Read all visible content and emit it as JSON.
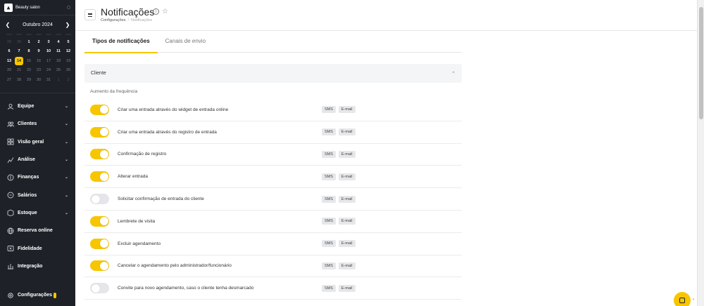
{
  "app": {
    "name": "Beauty salon"
  },
  "calendar": {
    "month": "Outubro 2024",
    "days": [
      {
        "d": "29",
        "t": "muted"
      },
      {
        "d": "30",
        "t": "muted"
      },
      {
        "d": "1",
        "t": "n"
      },
      {
        "d": "2",
        "t": "n"
      },
      {
        "d": "3",
        "t": "n"
      },
      {
        "d": "4",
        "t": "n"
      },
      {
        "d": "5",
        "t": "n"
      },
      {
        "d": "6",
        "t": "n"
      },
      {
        "d": "7",
        "t": "n"
      },
      {
        "d": "8",
        "t": "n"
      },
      {
        "d": "9",
        "t": "n"
      },
      {
        "d": "10",
        "t": "n"
      },
      {
        "d": "11",
        "t": "n"
      },
      {
        "d": "12",
        "t": "n"
      },
      {
        "d": "13",
        "t": "n"
      },
      {
        "d": "14",
        "t": "today"
      },
      {
        "d": "15",
        "t": "dim"
      },
      {
        "d": "16",
        "t": "dim"
      },
      {
        "d": "17",
        "t": "dim"
      },
      {
        "d": "18",
        "t": "dim"
      },
      {
        "d": "19",
        "t": "dim"
      },
      {
        "d": "20",
        "t": "dim"
      },
      {
        "d": "21",
        "t": "dim"
      },
      {
        "d": "22",
        "t": "dim"
      },
      {
        "d": "23",
        "t": "dim"
      },
      {
        "d": "24",
        "t": "dim"
      },
      {
        "d": "25",
        "t": "dim"
      },
      {
        "d": "26",
        "t": "dim"
      },
      {
        "d": "27",
        "t": "dim"
      },
      {
        "d": "28",
        "t": "dim"
      },
      {
        "d": "29",
        "t": "dim"
      },
      {
        "d": "30",
        "t": "dim"
      },
      {
        "d": "31",
        "t": "dim"
      },
      {
        "d": "1",
        "t": "muted"
      },
      {
        "d": "2",
        "t": "muted"
      }
    ]
  },
  "nav": [
    {
      "label": "Equipe",
      "icon": "user-icon",
      "chevron": true
    },
    {
      "label": "Clientes",
      "icon": "users-icon",
      "chevron": true
    },
    {
      "label": "Visão geral",
      "icon": "grid-icon",
      "chevron": true
    },
    {
      "label": "Análise",
      "icon": "analytics-icon",
      "chevron": true
    },
    {
      "label": "Finanças",
      "icon": "finance-icon",
      "chevron": true
    },
    {
      "label": "Salários",
      "icon": "salary-icon",
      "chevron": true
    },
    {
      "label": "Estoque",
      "icon": "stock-icon",
      "chevron": true
    },
    {
      "label": "Reserva online",
      "icon": "globe-icon",
      "chevron": false
    },
    {
      "label": "Fidelidade",
      "icon": "loyalty-icon",
      "chevron": false
    },
    {
      "label": "Integração",
      "icon": "integration-icon",
      "chevron": false
    }
  ],
  "settings": {
    "label": "Configurações"
  },
  "header": {
    "title": "Notificações",
    "breadcrumb": [
      "Configurações",
      "Notificações"
    ]
  },
  "tabs": [
    {
      "label": "Tipos de notificações",
      "active": true
    },
    {
      "label": "Canais de envio",
      "active": false
    }
  ],
  "section": {
    "title": "Cliente",
    "subsection": "Aumento da frequência"
  },
  "rows": [
    {
      "label": "Criar uma entrada através do widget de entrada online",
      "on": true
    },
    {
      "label": "Criar uma entrada através do registro de entrada",
      "on": true
    },
    {
      "label": "Confirmação de registro",
      "on": true
    },
    {
      "label": "Alterar entrada",
      "on": true
    },
    {
      "label": "Solicitar confirmação de entrada do cliente",
      "on": false
    },
    {
      "label": "Lembrete de visita",
      "on": true
    },
    {
      "label": "Excluir agendamento",
      "on": true
    },
    {
      "label": "Cancelar o agendamento pelo administrador/funcionário",
      "on": true
    },
    {
      "label": "Convite para novo agendamento, caso o cliente tenha desmarcado",
      "on": false
    }
  ],
  "chips": [
    "SMS",
    "E-mail"
  ],
  "colors": {
    "accent": "#f7c600",
    "sidebar": "#1e2228"
  }
}
